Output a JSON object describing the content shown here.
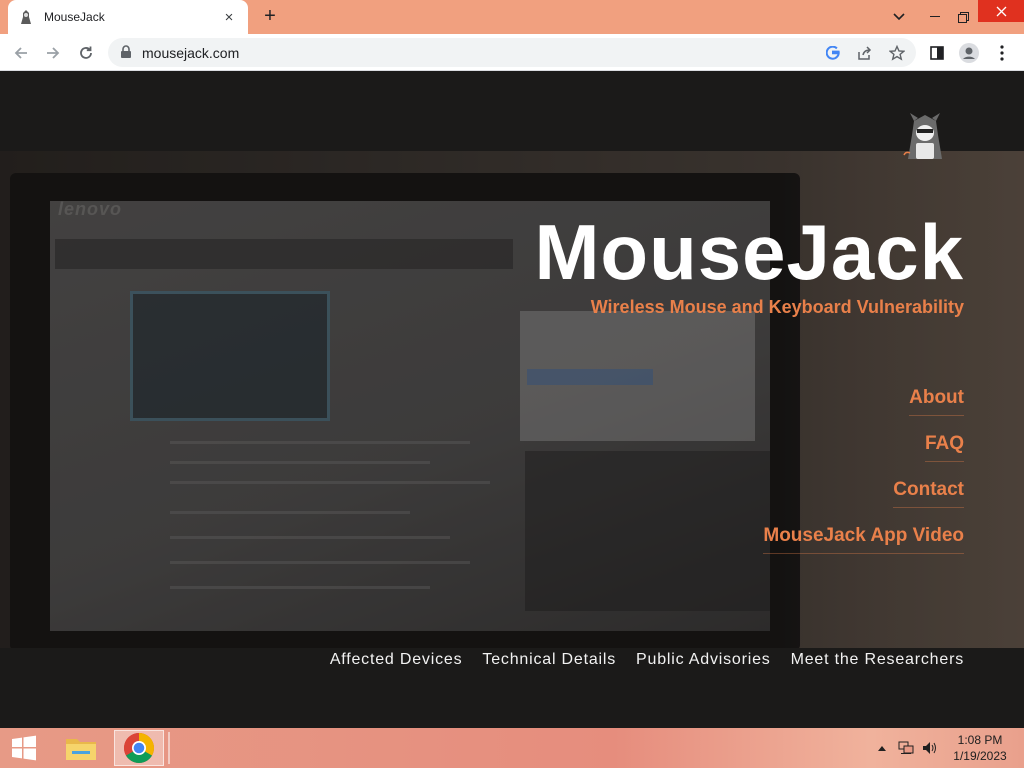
{
  "browser": {
    "tab_title": "MouseJack",
    "url": "mousejack.com",
    "new_tab_label": "+",
    "tab_close_label": "×"
  },
  "site": {
    "title": "MouseJack",
    "subtitle": "Wireless Mouse and Keyboard Vulnerability",
    "nav": [
      {
        "label": "About"
      },
      {
        "label": "FAQ"
      },
      {
        "label": "Contact"
      },
      {
        "label": "MouseJack App Video"
      }
    ],
    "footer_nav": [
      {
        "label": "Affected Devices"
      },
      {
        "label": "Technical Details"
      },
      {
        "label": "Public Advisories"
      },
      {
        "label": "Meet the Researchers"
      }
    ],
    "background_brand": "lenovo"
  },
  "taskbar": {
    "time": "1:08 PM",
    "date": "1/19/2023"
  },
  "colors": {
    "accent": "#e9804a",
    "tabstrip": "#f1a07f",
    "close_button": "#e0311f"
  }
}
